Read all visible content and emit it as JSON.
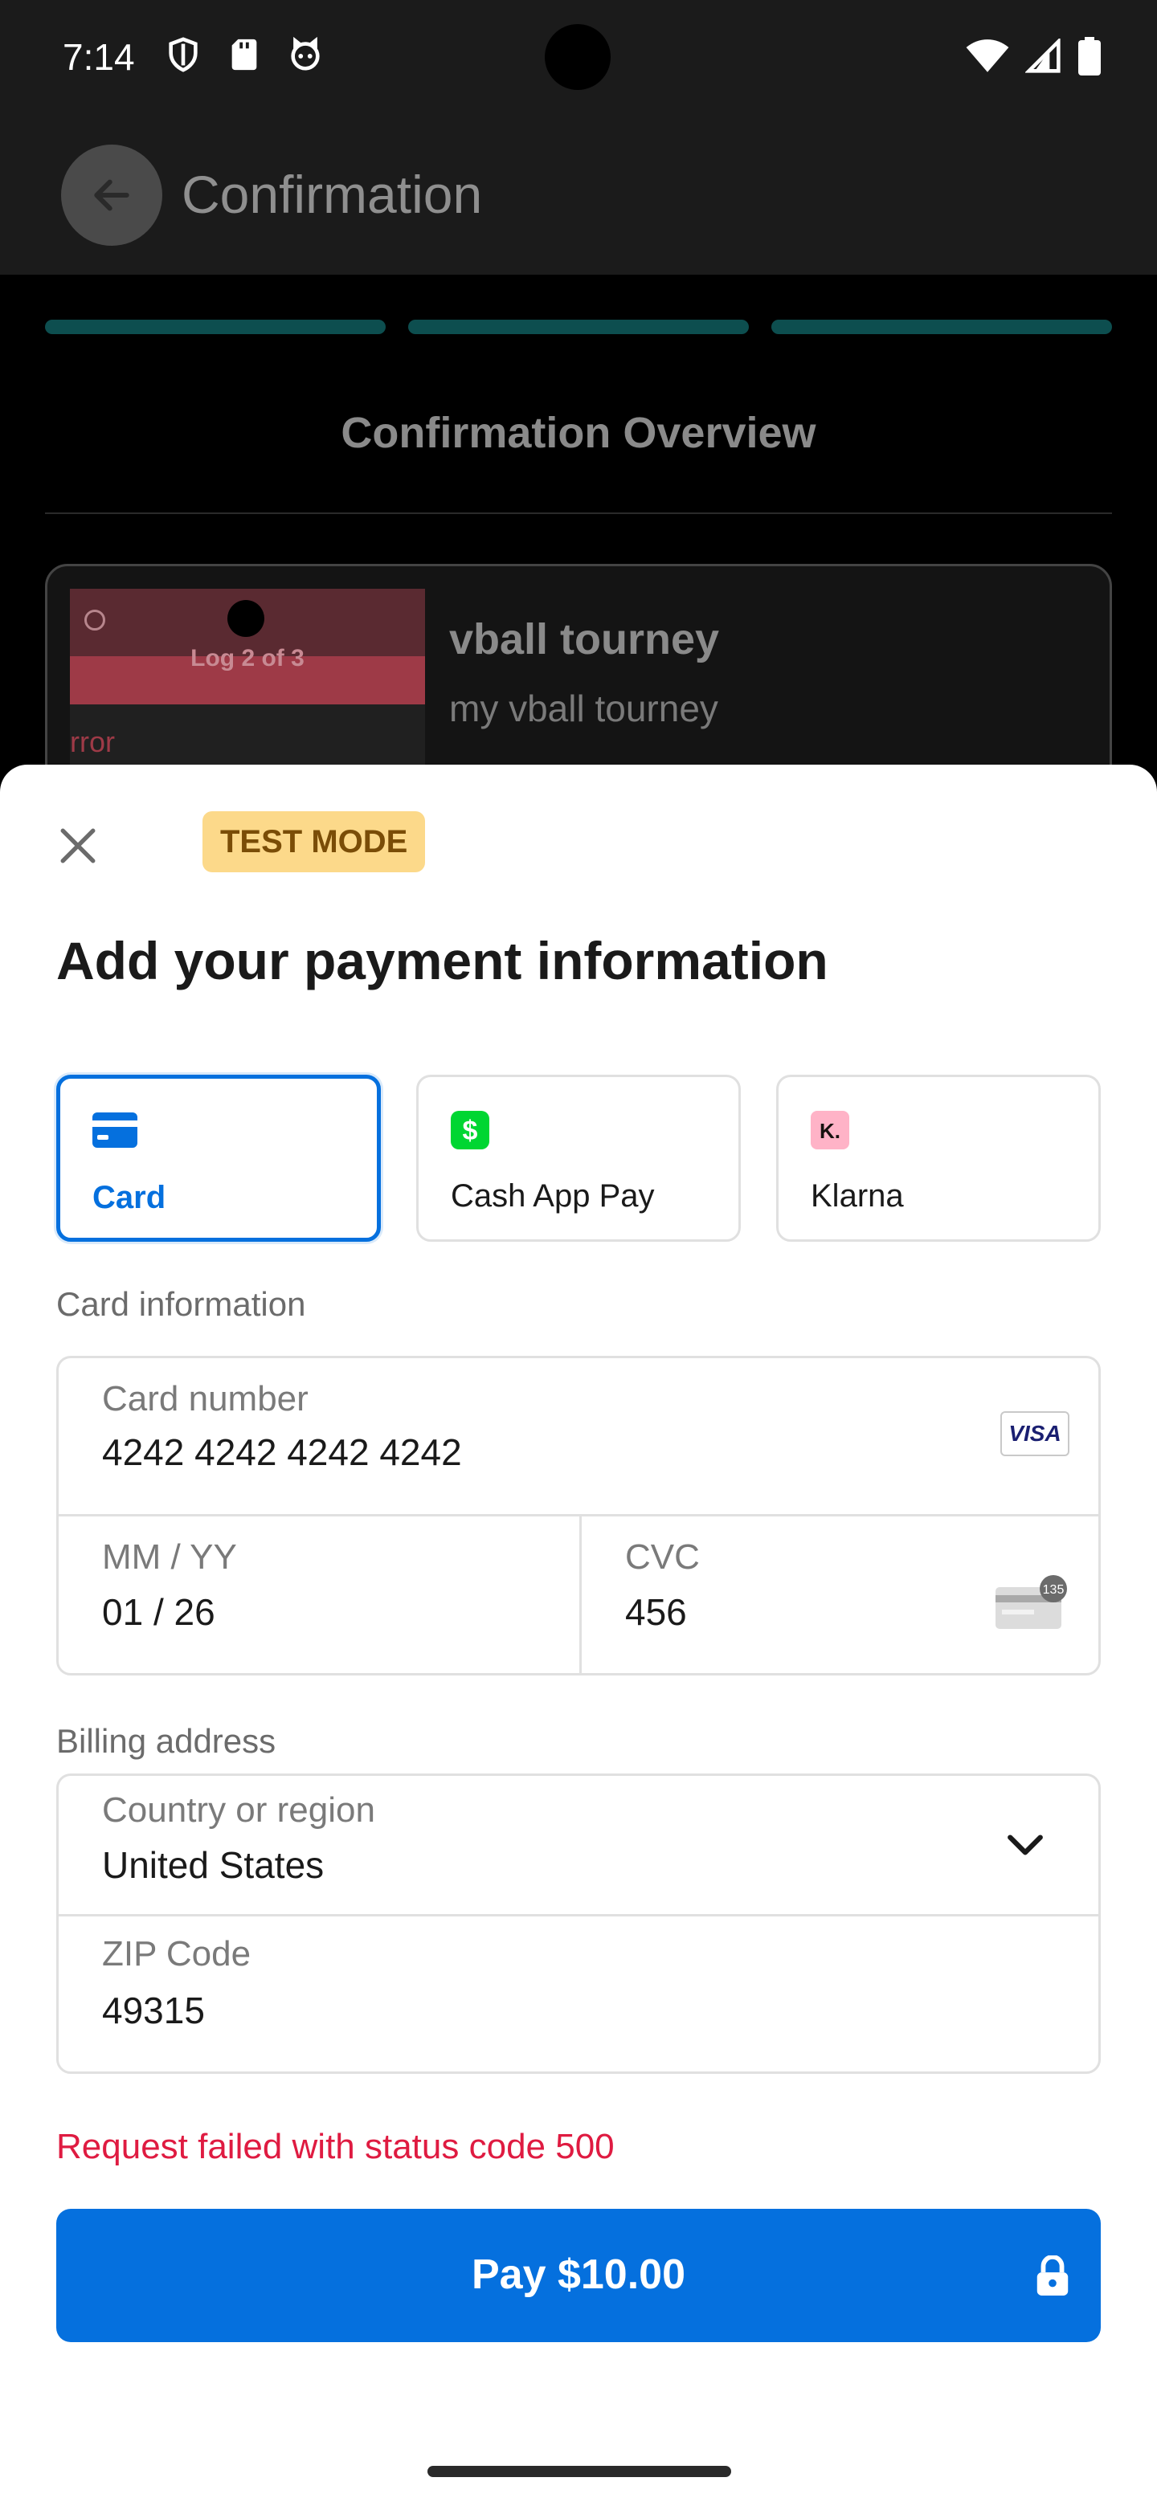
{
  "status_bar": {
    "time": "7:14"
  },
  "app_bar": {
    "title": "Confirmation"
  },
  "background": {
    "overview_title": "Confirmation Overview",
    "event": {
      "thumb_caption": "Log 2 of 3",
      "thumb_error": "rror",
      "title": "vball tourney",
      "subtitle": "my vball tourney"
    }
  },
  "sheet": {
    "badge": "TEST MODE",
    "title": "Add your payment information",
    "payment_methods": [
      {
        "label": "Card",
        "icon": "credit-card-icon",
        "selected": true
      },
      {
        "label": "Cash App Pay",
        "icon": "cash-app-icon",
        "selected": false
      },
      {
        "label": "Klarna",
        "icon": "klarna-icon",
        "selected": false
      }
    ],
    "card_section_label": "Card information",
    "card": {
      "number_label": "Card number",
      "number_value": "4242 4242 4242 4242",
      "brand": "VISA",
      "expiry_label": "MM / YY",
      "expiry_value": "01 / 26",
      "cvc_label": "CVC",
      "cvc_value": "456",
      "cvc_badge": "135"
    },
    "billing_section_label": "Billing address",
    "billing": {
      "country_label": "Country or region",
      "country_value": "United States",
      "zip_label": "ZIP Code",
      "zip_value": "49315"
    },
    "error": "Request failed with status code 500",
    "pay_button": "Pay $10.00"
  },
  "colors": {
    "accent": "#0570de",
    "error": "#df1b41",
    "badge_bg": "#fcd98a",
    "progress": "#0d4e4f"
  }
}
